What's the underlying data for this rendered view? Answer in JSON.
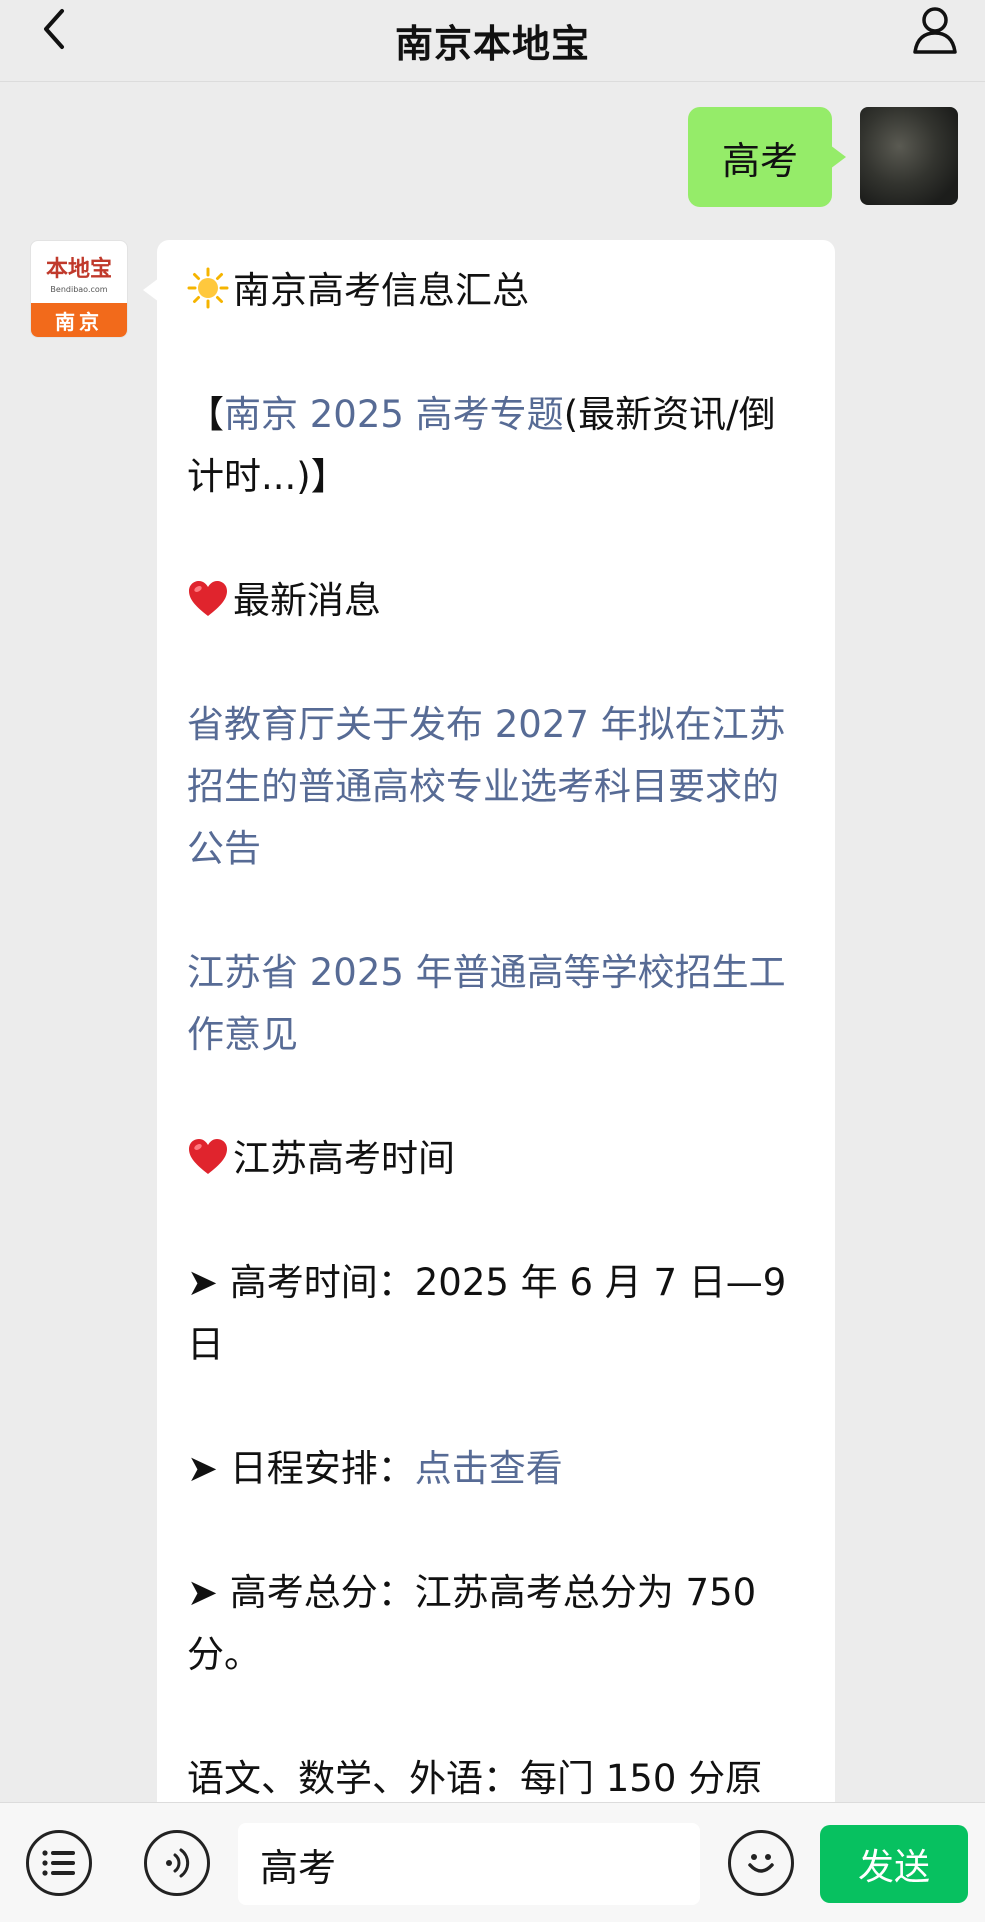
{
  "header": {
    "title": "南京本地宝",
    "back_icon": "chevron-left-icon",
    "profile_icon": "user-icon"
  },
  "chat": {
    "user_message": "高考",
    "bot_avatar": {
      "logo_text": "本地宝",
      "logo_sub": "Bendibao.com",
      "city": "南京"
    },
    "bot_message": {
      "heading": "南京高考信息汇总",
      "topic_prefix": "【",
      "topic_link": "南京 2025 高考专题",
      "topic_rest": "(最新资讯/倒计时...)】",
      "latest_heading": "最新消息",
      "news_1": "省教育厅关于发布 2027 年拟在江苏招生的普通高校专业选考科目要求的公告",
      "news_2": "江苏省 2025 年普通高等学校招生工作意见",
      "time_heading": "江苏高考时间",
      "exam_time": "➤ 高考时间：2025 年 6 月 7 日—9 日",
      "schedule_label": "➤ 日程安排：",
      "schedule_link": "点击查看",
      "total_score": "➤ 高考总分：江苏高考总分为 750 分。",
      "subjects": "语文、数学、外语：每门 150 分原"
    }
  },
  "input_bar": {
    "menu_icon": "list-menu-icon",
    "voice_icon": "voice-icon",
    "input_value": "高考",
    "emoji_icon": "smiley-icon",
    "send_label": "发送"
  },
  "colors": {
    "link": "#576b95",
    "user_bubble": "#95ec69",
    "send_button": "#07c160",
    "brand_orange": "#f26a1b"
  }
}
